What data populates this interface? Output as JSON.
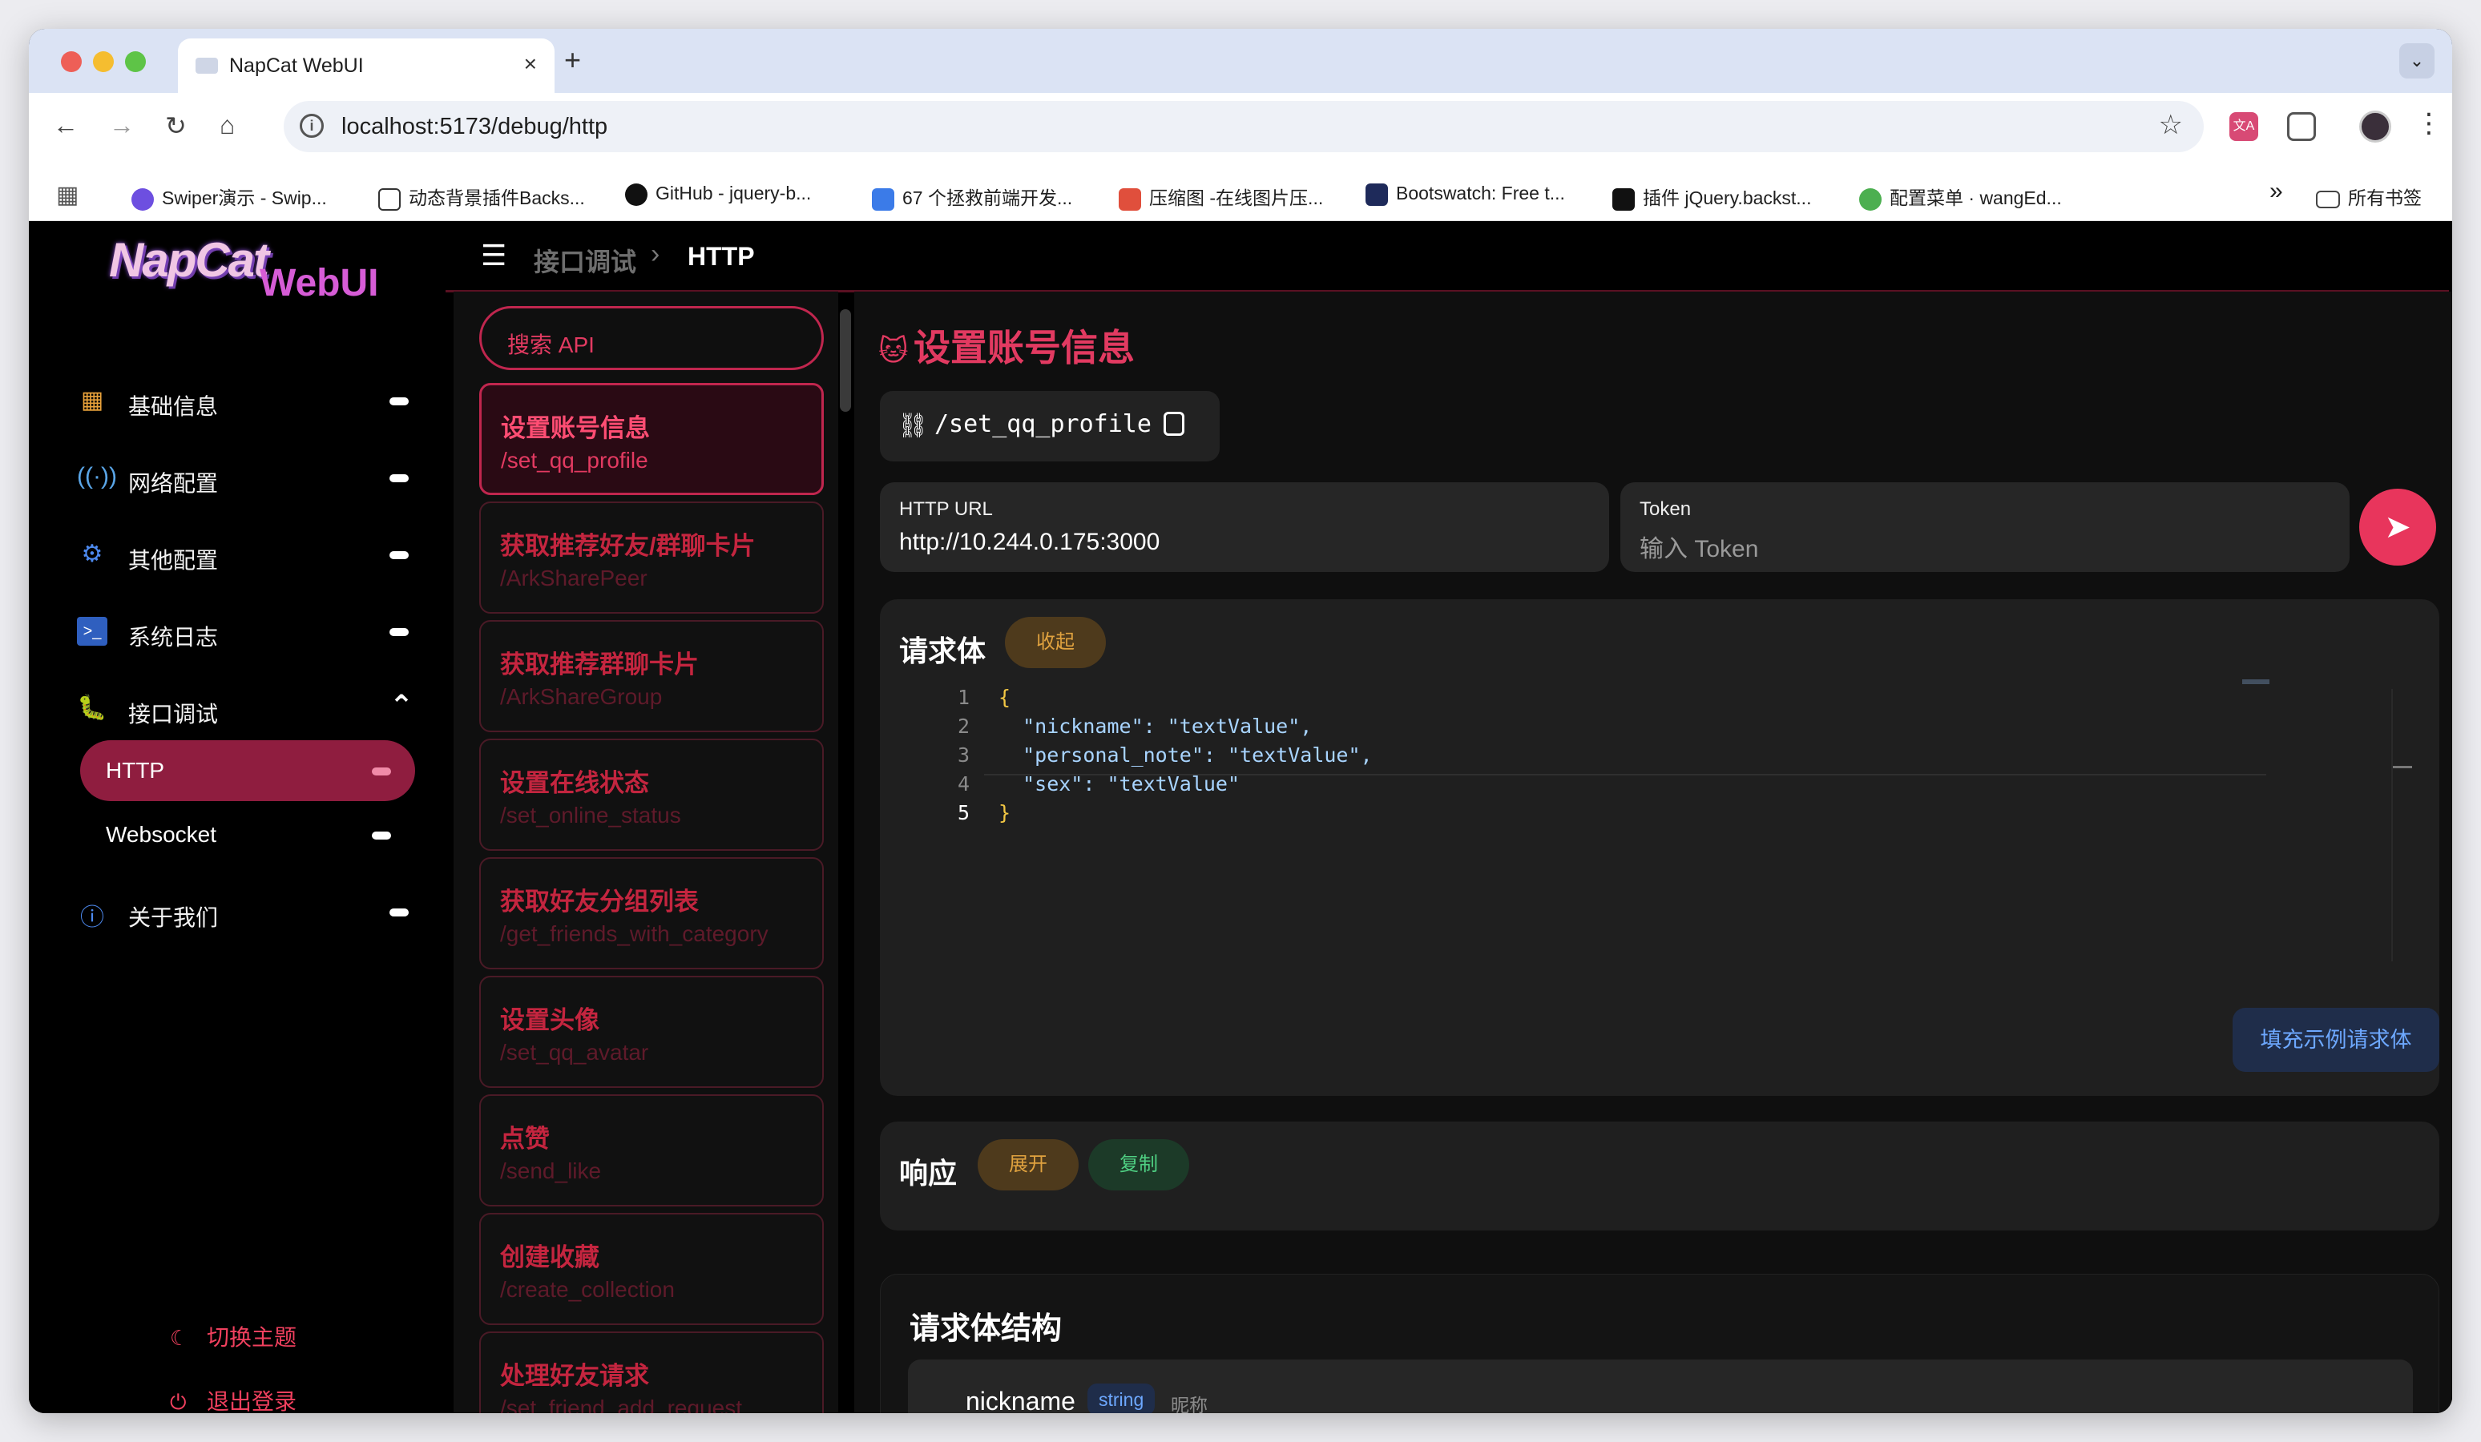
{
  "browser": {
    "tab_title": "NapCat WebUI",
    "tab_close": "×",
    "new_tab": "+",
    "url": "localhost:5173/debug/http",
    "bookmarks": [
      {
        "label": "Swiper演示 - Swip...",
        "icon_color": "#6d4fe0"
      },
      {
        "label": "动态背景插件Backs...",
        "icon_color": "#ffffff"
      },
      {
        "label": "GitHub - jquery-b...",
        "icon_color": "#111111"
      },
      {
        "label": "67 个拯救前端开发...",
        "icon_color": "#3b7be8"
      },
      {
        "label": "压缩图 -在线图片压...",
        "icon_color": "#e04f3c"
      },
      {
        "label": "Bootswatch: Free t...",
        "icon_color": "#1e2a5a"
      },
      {
        "label": "插件 jQuery.backst...",
        "icon_color": "#111111"
      },
      {
        "label": "配置菜单 · wangEd...",
        "icon_color": "#4caf50"
      }
    ],
    "bookmarks_overflow": "»",
    "all_bookmarks": "所有书签"
  },
  "sidebar": {
    "logo_art": "NapCat",
    "logo_text": "WebUI",
    "items": [
      {
        "label": "基础信息",
        "icon": "dashboard-icon"
      },
      {
        "label": "网络配置",
        "icon": "antenna-icon"
      },
      {
        "label": "其他配置",
        "icon": "gear-icon"
      },
      {
        "label": "系统日志",
        "icon": "terminal-icon"
      },
      {
        "label": "接口调试",
        "icon": "bug-icon"
      },
      {
        "label": "关于我们",
        "icon": "info-icon"
      }
    ],
    "sub_items": [
      {
        "label": "HTTP",
        "active": true
      },
      {
        "label": "Websocket",
        "active": false
      }
    ],
    "switch_theme": "切换主题",
    "logout": "退出登录"
  },
  "header": {
    "breadcrumb_parent": "接口调试",
    "breadcrumb_current": "HTTP"
  },
  "api_list": {
    "search_placeholder": "搜索 API",
    "items": [
      {
        "title": "设置账号信息",
        "path": "/set_qq_profile",
        "active": true
      },
      {
        "title": "获取推荐好友/群聊卡片",
        "path": "/ArkSharePeer",
        "active": false
      },
      {
        "title": "获取推荐群聊卡片",
        "path": "/ArkShareGroup",
        "active": false
      },
      {
        "title": "设置在线状态",
        "path": "/set_online_status",
        "active": false
      },
      {
        "title": "获取好友分组列表",
        "path": "/get_friends_with_category",
        "active": false
      },
      {
        "title": "设置头像",
        "path": "/set_qq_avatar",
        "active": false
      },
      {
        "title": "点赞",
        "path": "/send_like",
        "active": false
      },
      {
        "title": "创建收藏",
        "path": "/create_collection",
        "active": false
      },
      {
        "title": "处理好友请求",
        "path": "/set_friend_add_request",
        "active": false
      }
    ]
  },
  "main": {
    "title": "设置账号信息",
    "route": "/set_qq_profile",
    "http_url_label": "HTTP URL",
    "http_url_value": "http://10.244.0.175:3000",
    "token_label": "Token",
    "token_placeholder": "输入 Token",
    "request_body": {
      "title": "请求体",
      "collapse_label": "收起",
      "lines": [
        "{",
        "  \"nickname\": \"textValue\",",
        "  \"personal_note\": \"textValue\",",
        "  \"sex\": \"textValue\"",
        "}"
      ],
      "line_numbers": [
        "1",
        "2",
        "3",
        "4",
        "5"
      ],
      "fill_example_label": "填充示例请求体"
    },
    "response": {
      "title": "响应",
      "expand_label": "展开",
      "copy_label": "复制"
    },
    "structure": {
      "title": "请求体结构",
      "fields": [
        {
          "name": "nickname",
          "type": "string",
          "desc": "昵称"
        }
      ]
    }
  },
  "colors": {
    "accent": "#e23a61",
    "active_bg": "#8f1d3f",
    "panel_bg": "#1f1f1f"
  }
}
